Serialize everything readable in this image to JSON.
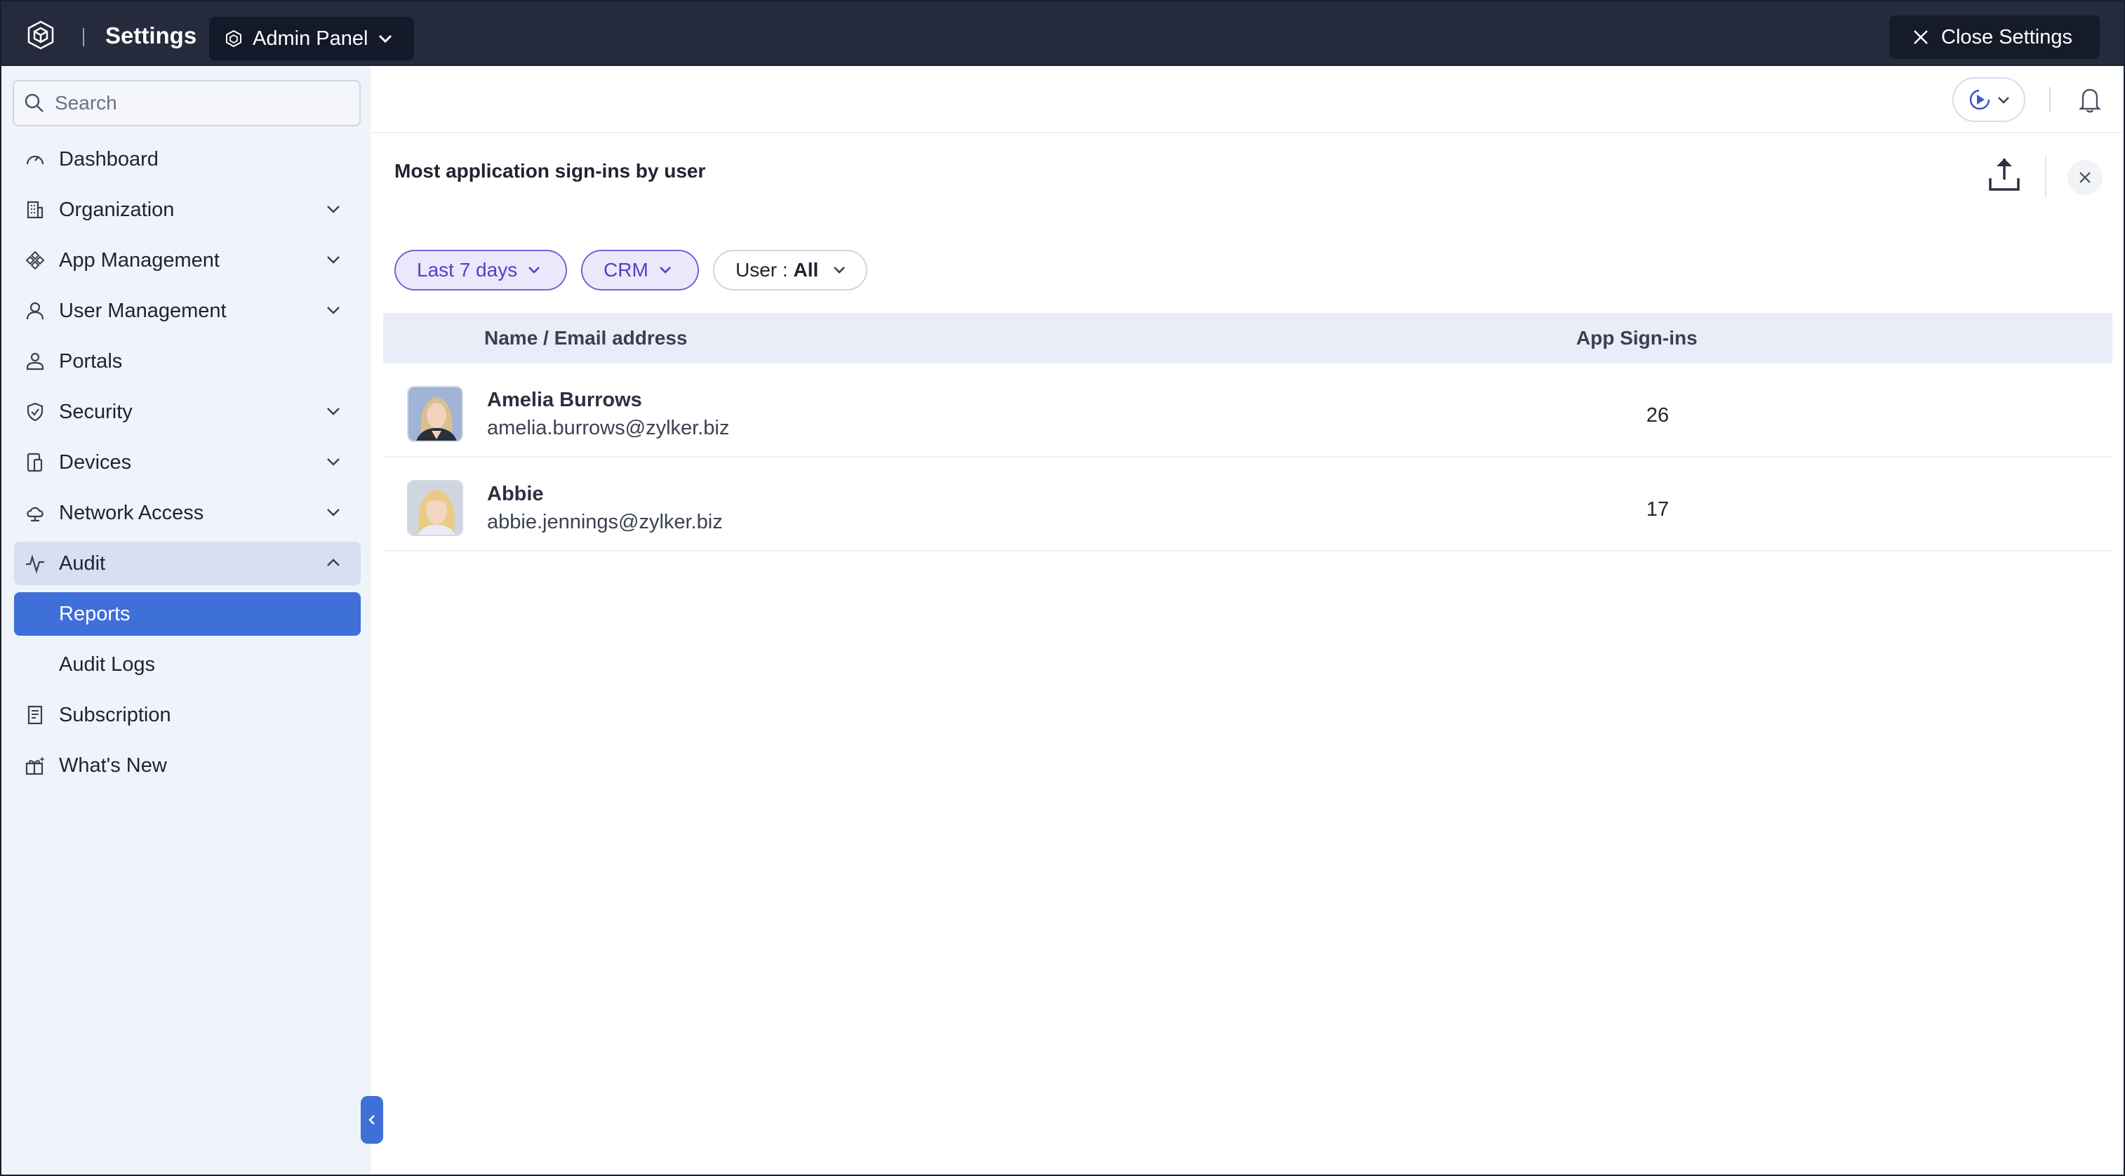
{
  "topbar": {
    "title": "Settings",
    "org_selector": "Admin Panel",
    "close_label": "Close Settings"
  },
  "sidebar": {
    "search_placeholder": "Search",
    "items": [
      {
        "label": "Dashboard",
        "icon": "gauge-icon",
        "expandable": false
      },
      {
        "label": "Organization",
        "icon": "building-icon",
        "expandable": true
      },
      {
        "label": "App Management",
        "icon": "apps-icon",
        "expandable": true
      },
      {
        "label": "User Management",
        "icon": "user-icon",
        "expandable": true
      },
      {
        "label": "Portals",
        "icon": "portal-icon",
        "expandable": false
      },
      {
        "label": "Security",
        "icon": "shield-icon",
        "expandable": true
      },
      {
        "label": "Devices",
        "icon": "devices-icon",
        "expandable": true
      },
      {
        "label": "Network Access",
        "icon": "cloud-icon",
        "expandable": true
      },
      {
        "label": "Audit",
        "icon": "activity-icon",
        "expandable": true,
        "expanded": true
      },
      {
        "label": "Reports",
        "sub": true,
        "active": true
      },
      {
        "label": "Audit Logs",
        "sub": true
      },
      {
        "label": "Subscription",
        "icon": "receipt-icon",
        "expandable": false
      },
      {
        "label": "What's New",
        "icon": "gift-icon",
        "expandable": false
      }
    ]
  },
  "report": {
    "title": "Most application sign-ins by user",
    "filters": {
      "period": "Last 7 days",
      "app": "CRM",
      "user_prefix": "User : ",
      "user_value": "All"
    },
    "columns": {
      "name": "Name / Email address",
      "signins": "App Sign-ins"
    },
    "rows": [
      {
        "name": "Amelia Burrows",
        "email": "amelia.burrows@zylker.biz",
        "signins": "26"
      },
      {
        "name": "Abbie",
        "email": "abbie.jennings@zylker.biz",
        "signins": "17"
      }
    ]
  },
  "colors": {
    "topbar": "#252b3c",
    "sidebar": "#eff3fa",
    "accent": "#3f6fd8",
    "chip_purple": "#5a3cc8"
  }
}
